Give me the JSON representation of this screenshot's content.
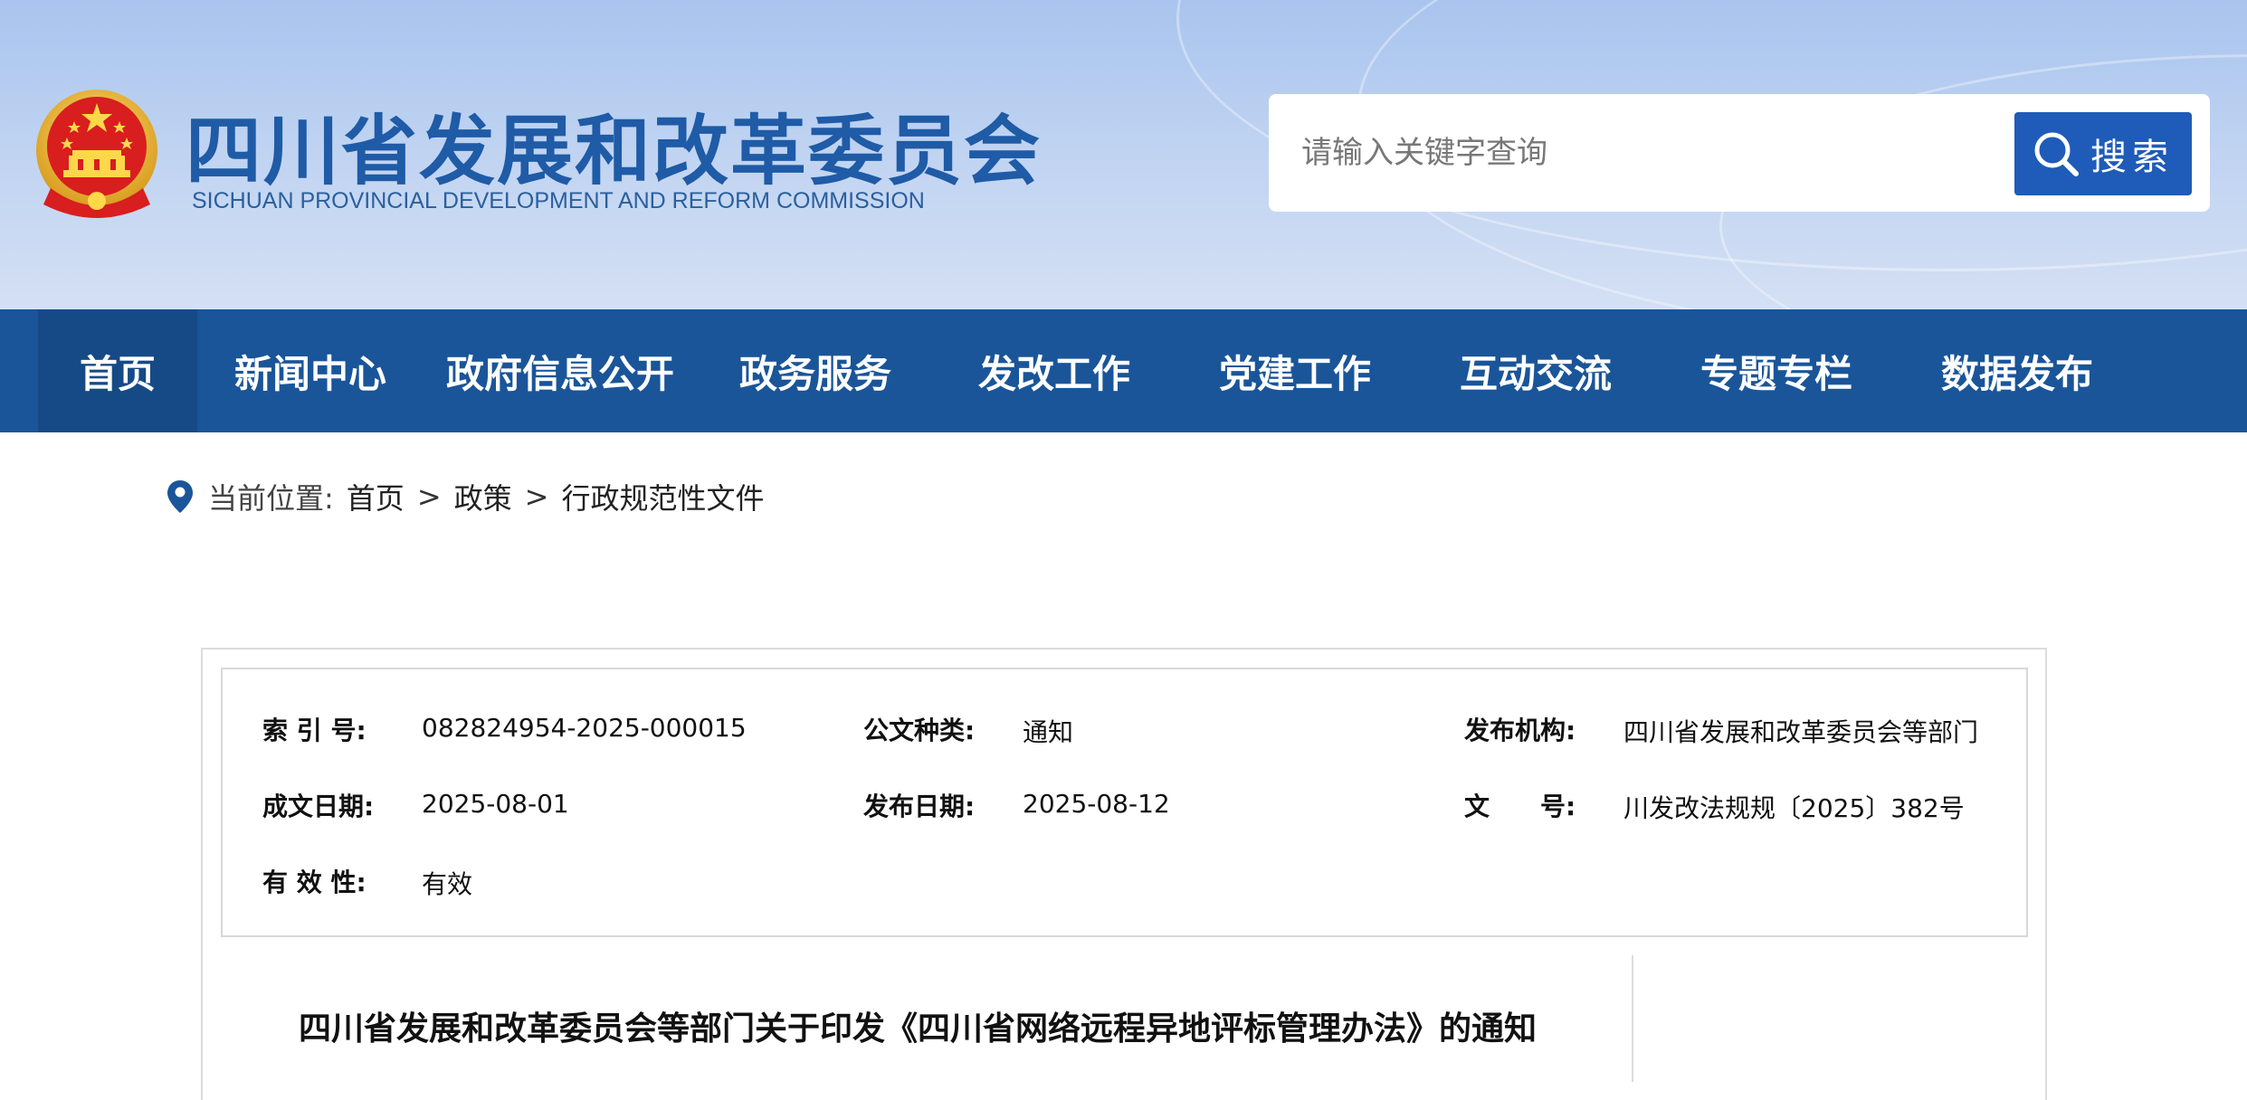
{
  "header": {
    "site_name_cn": "四川省发展和改革委员会",
    "site_name_en": "SICHUAN PROVINCIAL DEVELOPMENT AND REFORM COMMISSION",
    "emblem_icon": "national-emblem-icon",
    "search": {
      "placeholder": "请输入关键字查询",
      "value": "",
      "button_label": "搜索",
      "button_icon": "search-icon",
      "button_color": "#1f5bb8"
    }
  },
  "nav": {
    "background_color": "#1a5599",
    "active_color": "#164a86",
    "items": [
      {
        "label": "首页",
        "active": true
      },
      {
        "label": "新闻中心",
        "active": false
      },
      {
        "label": "政府信息公开",
        "active": false
      },
      {
        "label": "政务服务",
        "active": false
      },
      {
        "label": "发改工作",
        "active": false
      },
      {
        "label": "党建工作",
        "active": false
      },
      {
        "label": "互动交流",
        "active": false
      },
      {
        "label": "专题专栏",
        "active": false
      },
      {
        "label": "数据发布",
        "active": false
      }
    ]
  },
  "breadcrumb": {
    "icon": "location-pin-icon",
    "label": "当前位置:",
    "items": [
      "首页",
      "政策",
      "行政规范性文件"
    ],
    "separator": ">"
  },
  "meta": {
    "index_no_label": "索 引 号:",
    "index_no_value": "082824954-2025-000015",
    "doc_type_label": "公文种类:",
    "doc_type_value": "通知",
    "publisher_label": "发布机构:",
    "publisher_value": "四川省发展和改革委员会等部门",
    "written_date_label": "成文日期:",
    "written_date_value": "2025-08-01",
    "publish_date_label": "发布日期:",
    "publish_date_value": "2025-08-12",
    "doc_no_label": "文　　号:",
    "doc_no_value": "川发改法规规〔2025〕382号",
    "validity_label": "有 效 性:",
    "validity_value": "有效"
  },
  "article": {
    "title": "四川省发展和改革委员会等部门关于印发《四川省网络远程异地评标管理办法》的通知"
  }
}
